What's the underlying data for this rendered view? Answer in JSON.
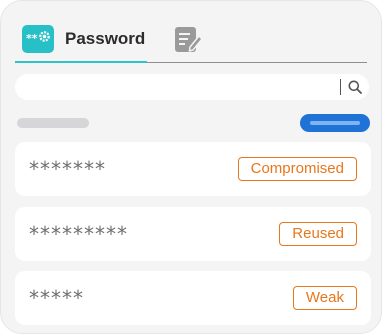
{
  "tabs": {
    "password_icon_text": "**",
    "password_label": "Password",
    "notes_icon": "notes-edit-icon"
  },
  "search": {
    "value": "",
    "placeholder": "",
    "icon": "search-icon"
  },
  "list": [
    {
      "masked": "*******",
      "status": "Compromised"
    },
    {
      "masked": "*********",
      "status": "Reused"
    },
    {
      "masked": "*****",
      "status": "Weak"
    }
  ],
  "colors": {
    "accent_teal": "#27c0c6",
    "primary_blue": "#1f73d6",
    "warning_orange": "#e8771c"
  }
}
